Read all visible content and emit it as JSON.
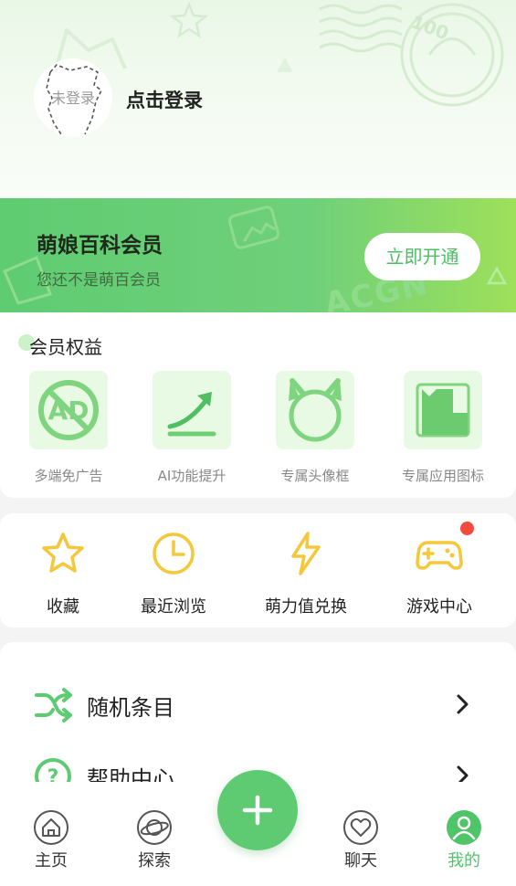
{
  "header": {
    "avatar_text": "未登录",
    "login_text": "点击登录",
    "stamp_text": "100"
  },
  "vip": {
    "title": "萌娘百科会员",
    "subtitle": "您还不是萌百会员",
    "button": "立即开通",
    "watermark": "ACGN"
  },
  "benefits": {
    "title": "会员权益",
    "items": [
      {
        "label": "多端免广告",
        "icon": "no-ads-icon"
      },
      {
        "label": "AI功能提升",
        "icon": "arrow-up-icon"
      },
      {
        "label": "专属头像框",
        "icon": "cat-frame-icon"
      },
      {
        "label": "专属应用图标",
        "icon": "app-icon"
      }
    ]
  },
  "quick": {
    "items": [
      {
        "label": "收藏",
        "icon": "star-icon"
      },
      {
        "label": "最近浏览",
        "icon": "clock-icon"
      },
      {
        "label": "萌力值兑换",
        "icon": "lightning-icon"
      },
      {
        "label": "游戏中心",
        "icon": "gamepad-icon"
      }
    ]
  },
  "list": {
    "items": [
      {
        "label": "随机条目",
        "icon": "shuffle-icon"
      },
      {
        "label": "帮助中心",
        "icon": "help-icon"
      }
    ]
  },
  "tabbar": {
    "items": [
      {
        "label": "主页",
        "icon": "home-icon"
      },
      {
        "label": "探索",
        "icon": "planet-icon"
      },
      {
        "label": "聊天",
        "icon": "heart-chat-icon"
      },
      {
        "label": "我的",
        "icon": "user-icon"
      }
    ],
    "fab_icon": "plus-icon"
  },
  "colors": {
    "accent": "#5ecb73",
    "vip_gradient_start": "#5fcc72",
    "vip_gradient_end": "#9ee05a",
    "benefit_bg": "#e8fae4",
    "quick_icon": "#f5c83b",
    "badge_red": "#f24a3c"
  }
}
